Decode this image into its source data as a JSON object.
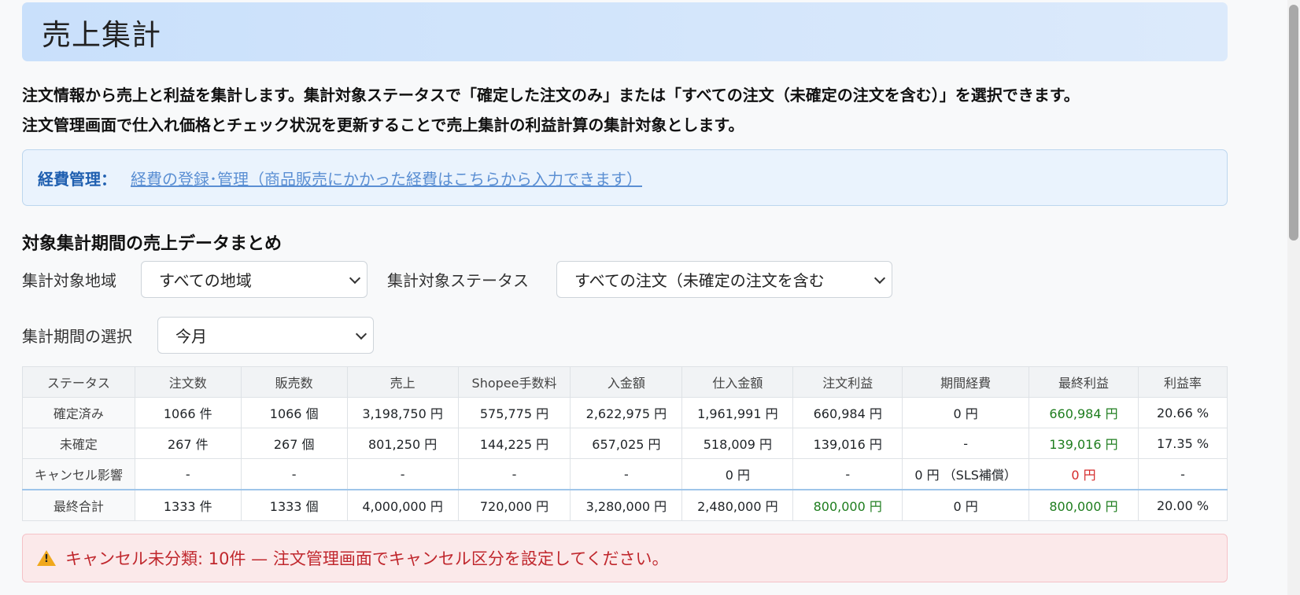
{
  "header": {
    "title": "売上集計"
  },
  "description": {
    "line1": "注文情報から売上と利益を集計します。集計対象ステータスで「確定した注文のみ」または「すべての注文（未確定の注文を含む）」を選択できます。",
    "line2": "注文管理画面で仕入れ価格とチェック状況を更新することで売上集計の利益計算の集計対象とします。"
  },
  "expense": {
    "label": "経費管理：",
    "link_text": "経費の登録･管理（商品販売にかかった経費はこちらから入力できます）"
  },
  "section": {
    "title": "対象集計期間の売上データまとめ"
  },
  "filters": {
    "region_label": "集計対象地域",
    "region_value": "すべての地域",
    "status_label": "集計対象ステータス",
    "status_value": "すべての注文（未確定の注文を含む",
    "period_label": "集計期間の選択",
    "period_value": "今月"
  },
  "table": {
    "headers": [
      "ステータス",
      "注文数",
      "販売数",
      "売上",
      "Shopee手数料",
      "入金額",
      "仕入金額",
      "注文利益",
      "期間経費",
      "最終利益",
      "利益率"
    ],
    "rows": [
      [
        "確定済み",
        "1066 件",
        "1066 個",
        "3,198,750 円",
        "575,775 円",
        "2,622,975 円",
        "1,961,991 円",
        "660,984 円",
        "0 円",
        "660,984 円",
        "20.66 %"
      ],
      [
        "未確定",
        "267 件",
        "267 個",
        "801,250 円",
        "144,225 円",
        "657,025 円",
        "518,009 円",
        "139,016 円",
        "-",
        "139,016 円",
        "17.35 %"
      ],
      [
        "キャンセル影響",
        "-",
        "-",
        "-",
        "-",
        "-",
        "0 円",
        "-",
        "0 円 （SLS補償）",
        "0 円",
        "-"
      ],
      [
        "最終合計",
        "1333 件",
        "1333 個",
        "4,000,000 円",
        "720,000 円",
        "3,280,000 円",
        "2,480,000 円",
        "800,000 円",
        "0 円",
        "800,000 円",
        "20.00 %"
      ]
    ]
  },
  "alert": {
    "text": "キャンセル未分類: 10件 — 注文管理画面でキャンセル区分を設定してください。"
  },
  "colors": {
    "profit_positive": "#1e7d1e",
    "profit_zero": "#d42a2a",
    "alert_text": "#c0272d"
  }
}
